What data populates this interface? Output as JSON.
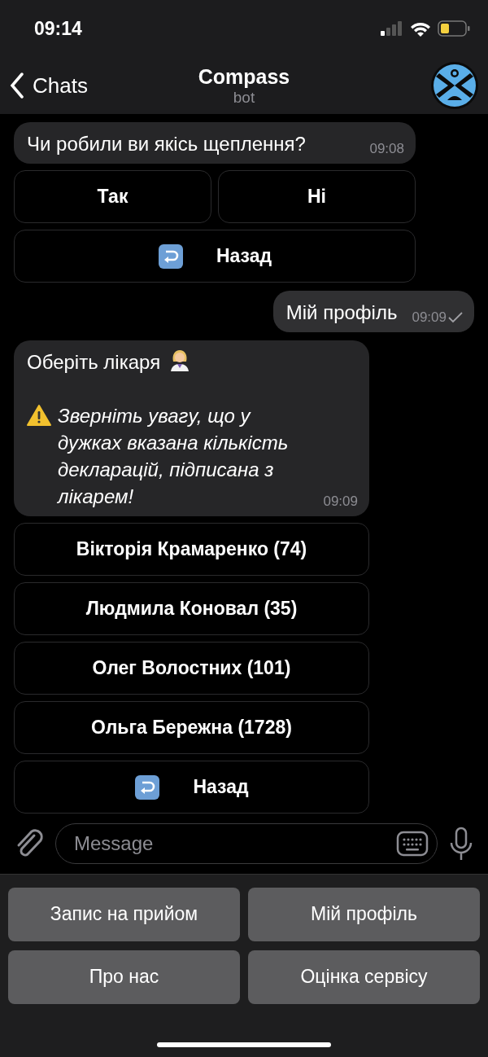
{
  "status_bar": {
    "time": "09:14"
  },
  "nav": {
    "back_label": "Chats",
    "title": "Compass",
    "subtitle": "bot"
  },
  "messages": [
    {
      "kind": "incoming",
      "paragraphs": [
        {
          "kind": "plain",
          "text": "Чи робили ви якісь щеплення?",
          "italic": false
        }
      ],
      "time": "09:08",
      "keyboard": [
        [
          {
            "kind": "plain",
            "label": "Так"
          },
          {
            "kind": "plain",
            "label": "Ні"
          }
        ],
        [
          {
            "kind": "back",
            "label": "Назад"
          }
        ]
      ]
    },
    {
      "kind": "outgoing",
      "paragraphs": [
        {
          "kind": "plain",
          "text": "Мій профіль",
          "italic": false
        }
      ],
      "time": "09:09",
      "read": true
    },
    {
      "kind": "incoming",
      "paragraphs": [
        {
          "kind": "doctor",
          "text": "Оберіть лікаря",
          "italic": false
        },
        {
          "kind": "warning",
          "text": "Зверніть увагу, що у дужках вказана кількість декларацій, підписана з лікарем!",
          "italic": true
        }
      ],
      "time": "09:09",
      "keyboard": [
        [
          {
            "kind": "plain",
            "label": "Вікторія Крамаренко (74)"
          }
        ],
        [
          {
            "kind": "plain",
            "label": "Людмила Коновал (35)"
          }
        ],
        [
          {
            "kind": "plain",
            "label": "Олег Волостних (101)"
          }
        ],
        [
          {
            "kind": "plain",
            "label": "Ольга Бережна (1728)"
          }
        ],
        [
          {
            "kind": "back",
            "label": "Назад"
          }
        ]
      ]
    }
  ],
  "composer": {
    "placeholder": "Message"
  },
  "reply_keyboard": [
    [
      "Запис на прийом",
      "Мій профіль"
    ],
    [
      "Про нас",
      "Оцінка сервісу"
    ]
  ]
}
